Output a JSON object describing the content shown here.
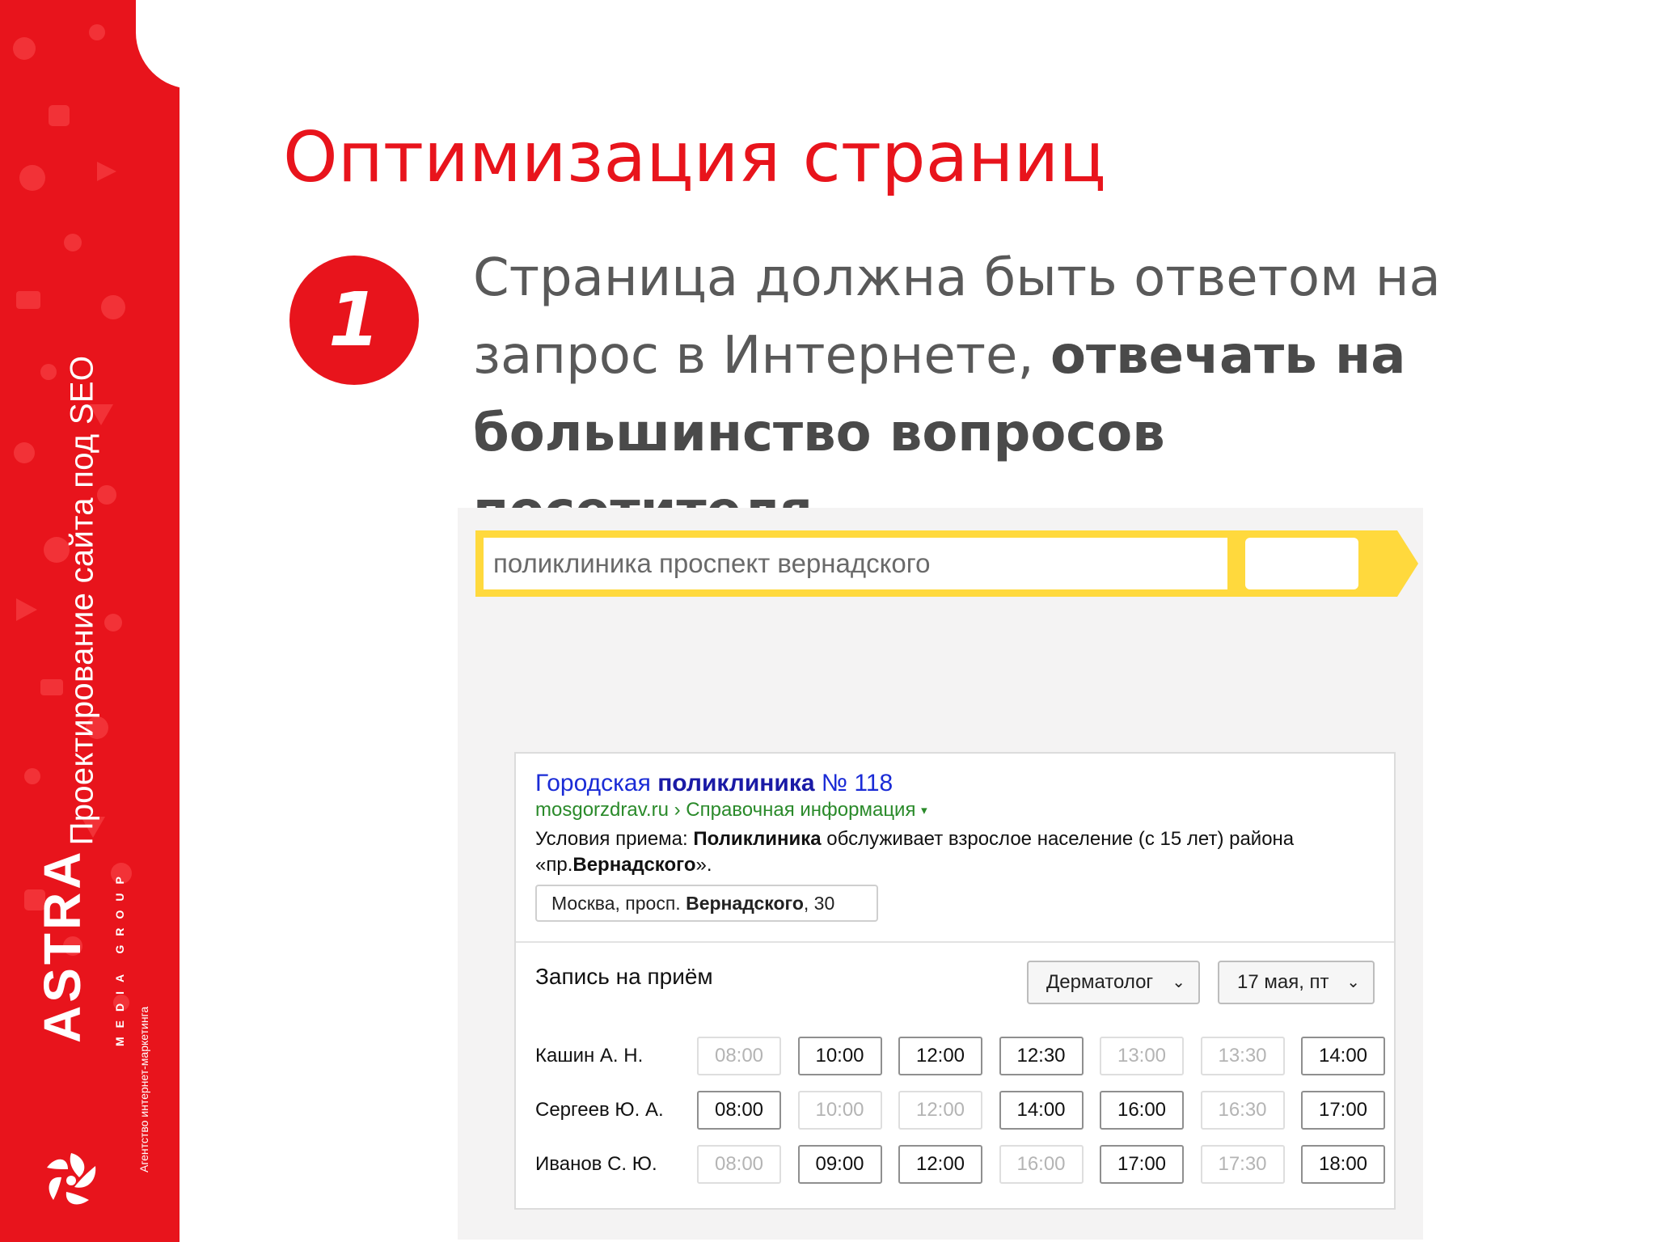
{
  "sidebar": {
    "vertical_title": "Проектирование сайта под SEO",
    "logo": {
      "name": "ASTRA",
      "sub": "MEDIA GROUP",
      "tagline": "Агентство интернет-маркетинга"
    }
  },
  "slide": {
    "title": "Оптимизация страниц",
    "step_number": "1",
    "lead_normal": "Страница должна быть ответом на запрос в Интернете, ",
    "lead_bold": "отвечать на большинство вопросов посетителя"
  },
  "search": {
    "query": "поликлиника проспект вернадского"
  },
  "result": {
    "title_normal": "Городская ",
    "title_bold": "поликлиника",
    "title_end": " № 118",
    "url": "mosgorzdrav.ru › Справочная информация",
    "url_arrow": "▾",
    "snippet_a": "Условия приема: ",
    "snippet_b": "Поликлиника",
    "snippet_c": " обслуживает взрослое население (с 15 лет) района «пр.",
    "snippet_d": "Вернадского",
    "snippet_e": "».",
    "address_a": "Москва, просп. ",
    "address_b": "Вернадского",
    "address_c": ", 30"
  },
  "booking": {
    "title": "Запись на приём",
    "specialty": "Дерматолог",
    "date": "17 мая, пт",
    "chevron": "⌄",
    "doctors": [
      {
        "name": "Кашин А. Н.",
        "slots": [
          {
            "time": "08:00",
            "available": false
          },
          {
            "time": "10:00",
            "available": true
          },
          {
            "time": "12:00",
            "available": true
          },
          {
            "time": "12:30",
            "available": true
          },
          {
            "time": "13:00",
            "available": false
          },
          {
            "time": "13:30",
            "available": false
          },
          {
            "time": "14:00",
            "available": true
          }
        ]
      },
      {
        "name": "Сергеев Ю. А.",
        "slots": [
          {
            "time": "08:00",
            "available": true
          },
          {
            "time": "10:00",
            "available": false
          },
          {
            "time": "12:00",
            "available": false
          },
          {
            "time": "14:00",
            "available": true
          },
          {
            "time": "16:00",
            "available": true
          },
          {
            "time": "16:30",
            "available": false
          },
          {
            "time": "17:00",
            "available": true
          }
        ]
      },
      {
        "name": "Иванов С. Ю.",
        "slots": [
          {
            "time": "08:00",
            "available": false
          },
          {
            "time": "09:00",
            "available": true
          },
          {
            "time": "12:00",
            "available": true
          },
          {
            "time": "16:00",
            "available": false
          },
          {
            "time": "17:00",
            "available": true
          },
          {
            "time": "17:30",
            "available": false
          },
          {
            "time": "18:00",
            "available": true
          }
        ]
      }
    ]
  },
  "colors": {
    "brand_red": "#e8141c",
    "search_yellow": "#ffd93d",
    "link_blue": "#1a2bd6",
    "url_green": "#2a8a2a"
  }
}
